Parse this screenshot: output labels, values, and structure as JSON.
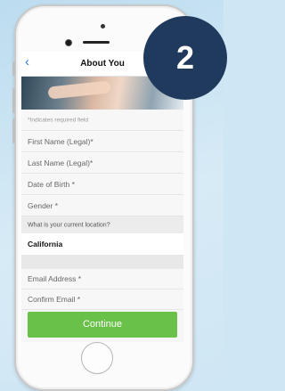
{
  "step_badge": "2",
  "nav": {
    "back_icon": "chevron-left-icon",
    "title": "About You"
  },
  "form": {
    "required_note": "*Indicates required field",
    "fields": [
      {
        "label": "First Name (Legal)*"
      },
      {
        "label": "Last Name (Legal)*"
      },
      {
        "label": "Date of Birth *"
      },
      {
        "label": "Gender *"
      }
    ],
    "location_question": "What is your current location?",
    "location_value": "California",
    "contact_fields": [
      {
        "label": "Email Address *"
      },
      {
        "label": "Confirm Email *"
      }
    ],
    "continue_label": "Continue"
  },
  "colors": {
    "accent": "#6ac14a",
    "badge": "#1f3a5c",
    "link": "#2b7bd6"
  }
}
